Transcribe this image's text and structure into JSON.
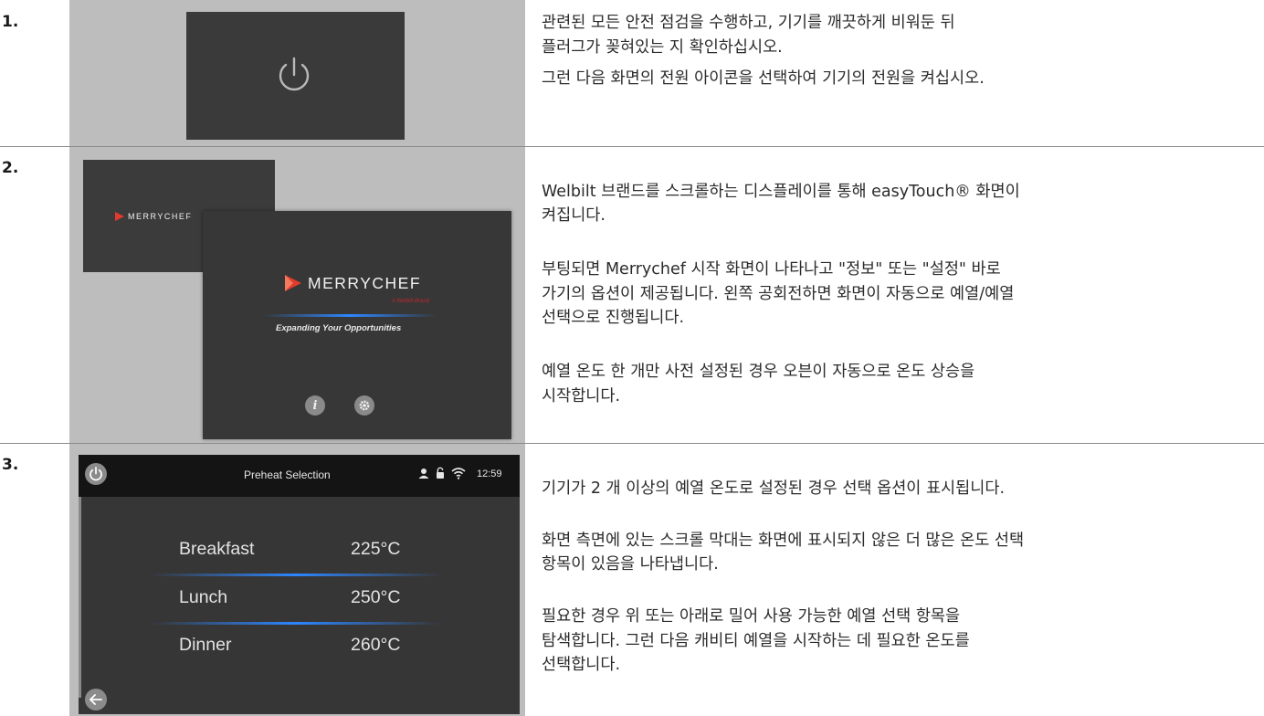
{
  "steps": [
    {
      "num": "1.",
      "paragraphs": [
        "관련된 모든 안전 점검을 수행하고, 기기를 깨끗하게 비워둔 뒤",
        "플러그가 꽂혀있는 지 확인하십시오.",
        "그런 다음 화면의 전원 아이콘을 선택하여 기기의 전원을 켜십시오."
      ]
    },
    {
      "num": "2.",
      "paragraphs": [
        "Welbilt 브랜드를 스크롤하는 디스플레이를 통해 easyTouch® 화면이\n켜집니다.",
        "부팅되면 Merrychef 시작 화면이 나타나고 \"정보\" 또는 \"설정\" 바로\n가기의 옵션이 제공됩니다. 왼쪽 공회전하면 화면이 자동으로 예열/예열\n선택으로 진행됩니다.",
        "예열 온도 한 개만 사전 설정된 경우 오븐이 자동으로 온도 상승을\n시작합니다."
      ],
      "screen": {
        "brand_small": "MERRYCHEF",
        "brand_large": "MERRYCHEF",
        "sub_brand": "A Welbilt Brand",
        "tagline": "Expanding Your Opportunities"
      }
    },
    {
      "num": "3.",
      "paragraphs": [
        "기기가 2 개 이상의 예열 온도로 설정된 경우 선택 옵션이 표시됩니다.",
        "화면 측면에 있는 스크롤 막대는 화면에 표시되지 않은 더 많은 온도 선택\n항목이 있음을 나타냅니다.",
        "필요한 경우 위 또는 아래로 밀어 사용 가능한 예열 선택 항목을\n탐색합니다. 그런 다음 캐비티 예열을 시작하는 데 필요한 온도를\n선택합니다."
      ],
      "screen": {
        "title": "Preheat Selection",
        "time": "12:59",
        "items": [
          {
            "name": "Breakfast",
            "temp": "225°C"
          },
          {
            "name": "Lunch",
            "temp": "250°C"
          },
          {
            "name": "Dinner",
            "temp": "260°C"
          }
        ]
      }
    }
  ],
  "colors": {
    "screen_bg": "#383838",
    "accent_blue": "#2d86ff",
    "brand_red": "#c0262c"
  },
  "icons": [
    "power-icon",
    "merrychef-logo-icon",
    "info-icon",
    "settings-gear-icon",
    "user-icon",
    "lock-icon",
    "wifi-icon",
    "back-arrow-icon"
  ]
}
